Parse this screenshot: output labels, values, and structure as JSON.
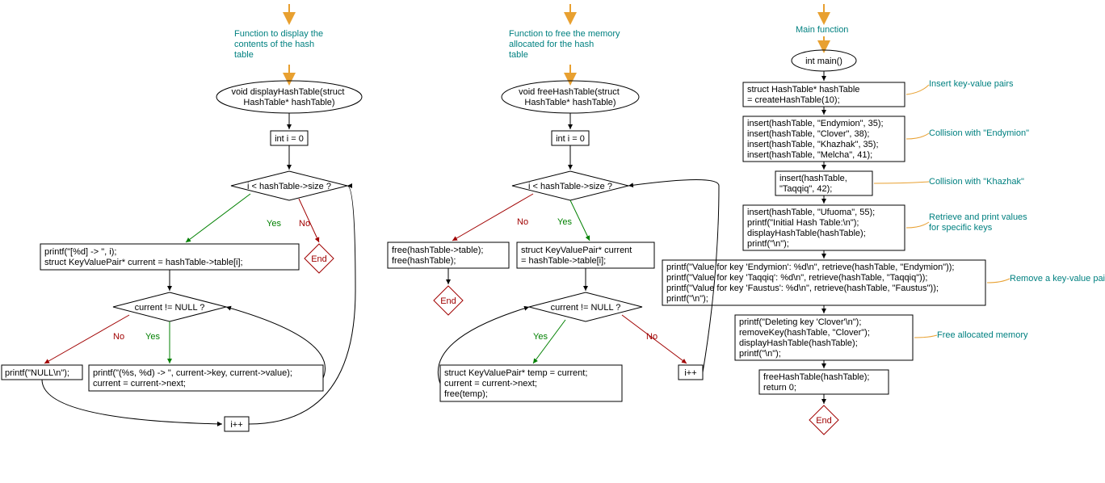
{
  "chart1": {
    "comment": "Function to display the\ncontents of the hash\ntable",
    "func": "void displayHashTable(struct\nHashTable* hashTable)",
    "init": "int i = 0",
    "cond1": "i < hashTable->size ?",
    "yes1": "Yes",
    "no1": "No",
    "end1": "End",
    "block1": "printf(\"[%d] -> \", i);\nstruct KeyValuePair* current = hashTable->table[i];",
    "cond2": "current != NULL ?",
    "yes2": "Yes",
    "no2": "No",
    "nullBlock": "printf(\"NULL\\n\");",
    "inner": "printf(\"(%s, %d) -> \", current->key, current->value);\ncurrent = current->next;",
    "inc": "i++"
  },
  "chart2": {
    "comment": "Function to free the memory\nallocated for the hash\ntable",
    "func": "void freeHashTable(struct\nHashTable* hashTable)",
    "init": "int i = 0",
    "cond1": "i < hashTable->size ?",
    "yes1": "Yes",
    "no1": "No",
    "freeFinal": "free(hashTable->table);\nfree(hashTable);",
    "end1": "End",
    "structBlock": "struct KeyValuePair* current\n= hashTable->table[i];",
    "cond2": "current != NULL ?",
    "yes2": "Yes",
    "no2": "No",
    "inner": "struct KeyValuePair* temp = current;\ncurrent = current->next;\nfree(temp);",
    "inc": "i++"
  },
  "chart3": {
    "comment": "Main function",
    "func": "int main()",
    "block1": "struct HashTable* hashTable\n= createHashTable(10);",
    "c1": "Insert key-value pairs",
    "block2": "insert(hashTable, \"Endymion\", 35);\ninsert(hashTable, \"Clover\", 38);\ninsert(hashTable, \"Khazhak\", 35);\ninsert(hashTable, \"Melcha\", 41);",
    "c2": "Collision with \"Endymion\"",
    "block3": "insert(hashTable,\n\"Taqqiq\", 42);",
    "c3": "Collision with \"Khazhak\"",
    "block4": "insert(hashTable, \"Ufuoma\", 55);\nprintf(\"Initial Hash Table:\\n\");\ndisplayHashTable(hashTable);\nprintf(\"\\n\");",
    "c4": "Retrieve and print values\nfor specific keys",
    "block5": "printf(\"Value for key 'Endymion': %d\\n\", retrieve(hashTable, \"Endymion\"));\nprintf(\"Value for key 'Taqqiq': %d\\n\", retrieve(hashTable, \"Taqqiq\"));\nprintf(\"Value for key 'Faustus': %d\\n\", retrieve(hashTable, \"Faustus\"));\nprintf(\"\\n\");",
    "c5": "Remove a key-value pair",
    "block6": "printf(\"Deleting key 'Clover'\\n\");\nremoveKey(hashTable, \"Clover\");\ndisplayHashTable(hashTable);\nprintf(\"\\n\");",
    "c6": "Free allocated memory",
    "block7": "freeHashTable(hashTable);\nreturn 0;",
    "end": "End"
  }
}
